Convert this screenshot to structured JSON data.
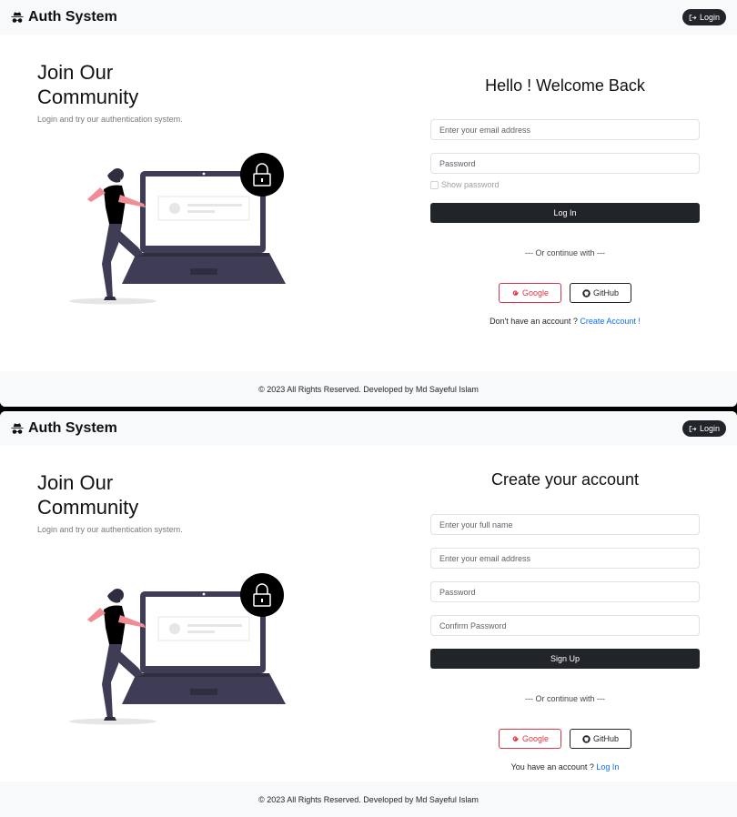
{
  "brand": {
    "name": "Auth System",
    "icon": "incognito-icon"
  },
  "nav": {
    "login_label": "Login",
    "login_icon": "box-arrow-in-icon"
  },
  "hero": {
    "title": "Join Our Community",
    "subtitle": "Login and try our authentication system."
  },
  "login_screen": {
    "title": "Hello ! Welcome Back",
    "email_placeholder": "Enter your email address",
    "password_placeholder": "Password",
    "show_password_label": "Show password",
    "submit_label": "Log In",
    "divider": "--- Or continue with ---",
    "alt_text": "Don't have an account ?",
    "alt_link": "Create Account !"
  },
  "signup_screen": {
    "title": "Create your account",
    "name_placeholder": "Enter your full name",
    "email_placeholder": "Enter your email address",
    "password_placeholder": "Password",
    "confirm_placeholder": "Confirm Password",
    "submit_label": "Sign Up",
    "divider": "--- Or continue with ---",
    "alt_text": "You have an account ?",
    "alt_link": "Log In"
  },
  "oauth": {
    "google_label": "Google",
    "github_label": "GitHub"
  },
  "footer": {
    "text": "© 2023 All Rights Reserved. Developed by Md Sayeful Islam"
  },
  "colors": {
    "dark": "#212529",
    "google": "#dc3545",
    "link": "#0d6efd",
    "illustration_dark": "#3f3d56",
    "illustration_pink": "#f08c96"
  }
}
